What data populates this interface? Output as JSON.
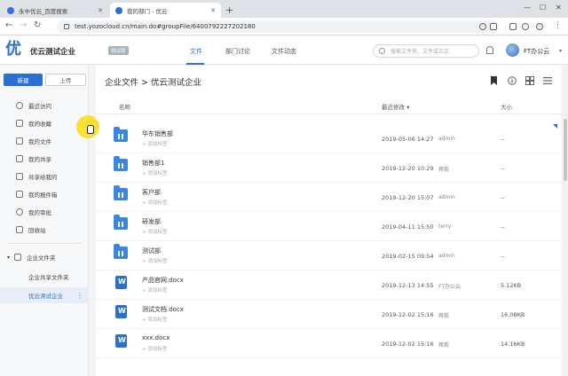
{
  "browser": {
    "tabs": [
      {
        "title": "永中优云_百度搜索",
        "active": false
      },
      {
        "title": "我的部门 - 优云",
        "active": true
      }
    ],
    "url": "test.yozocloud.cn/main.do#groupFile/6400792227202180"
  },
  "header": {
    "logo_char": "优",
    "company": "优云测试企业",
    "badge": "测试版",
    "nav": [
      "文件",
      "部门讨论",
      "文件动态"
    ],
    "search_placeholder": "搜索文件夹、文件或正文",
    "user": "FT办公云"
  },
  "sidebar": {
    "new_label": "新建",
    "upload_label": "上传",
    "items": [
      {
        "label": "最近访问",
        "icon": "clock-icon"
      },
      {
        "label": "我的收藏",
        "icon": "star-icon"
      },
      {
        "label": "我的文件",
        "icon": "folder-icon"
      },
      {
        "label": "我的共享",
        "icon": "share-icon"
      },
      {
        "label": "共享给我的",
        "icon": "share-in-icon"
      },
      {
        "label": "我的报件箱",
        "icon": "inbox-icon"
      },
      {
        "label": "我的审批",
        "icon": "approval-icon"
      },
      {
        "label": "回收站",
        "icon": "trash-icon"
      }
    ],
    "enterprise_group": "企业文件夹",
    "enterprise_items": [
      "企业共享文件夹",
      "优云测试企业"
    ]
  },
  "main": {
    "breadcrumb": "企业文件 > 优云测试企业",
    "columns": {
      "name": "名称",
      "modified": "最近修改",
      "size": "大小"
    },
    "rows": [
      {
        "name": "华东销售部",
        "tag": "+ 添加标签",
        "date": "2019-05-06 14:27",
        "owner": "admin",
        "size": "--",
        "kind": "folder"
      },
      {
        "name": "销售部1",
        "tag": "+ 添加标签",
        "date": "2019-12-20 10:29",
        "owner": "蒋毅",
        "size": "--",
        "kind": "folder"
      },
      {
        "name": "客户部",
        "tag": "+ 添加标签",
        "date": "2019-12-20 15:07",
        "owner": "admin",
        "size": "--",
        "kind": "folder"
      },
      {
        "name": "研发部",
        "tag": "+ 添加标签",
        "date": "2019-04-11 15:50",
        "owner": "terry",
        "size": "--",
        "kind": "folder"
      },
      {
        "name": "测试部",
        "tag": "+ 添加标签",
        "date": "2019-02-15 09:54",
        "owner": "admin",
        "size": "--",
        "kind": "folder"
      },
      {
        "name": "产品官网.docx",
        "tag": "+ 添加标签",
        "date": "2019-12-13 14:55",
        "owner": "FT办公云",
        "size": "5.12KB",
        "kind": "doc"
      },
      {
        "name": "测试文档.docx",
        "tag": "+ 添加标签",
        "date": "2019-12-02 15:16",
        "owner": "蒋毅",
        "size": "16.08KB",
        "kind": "doc"
      },
      {
        "name": "xxx.docx",
        "tag": "+ 添加标签",
        "date": "2019-12-02 15:16",
        "owner": "蒋毅",
        "size": "14.16KB",
        "kind": "doc"
      }
    ]
  },
  "colors": {
    "accent": "#2a6fd6",
    "folder": "#3a86e0",
    "doc": "#2b6fd1"
  }
}
